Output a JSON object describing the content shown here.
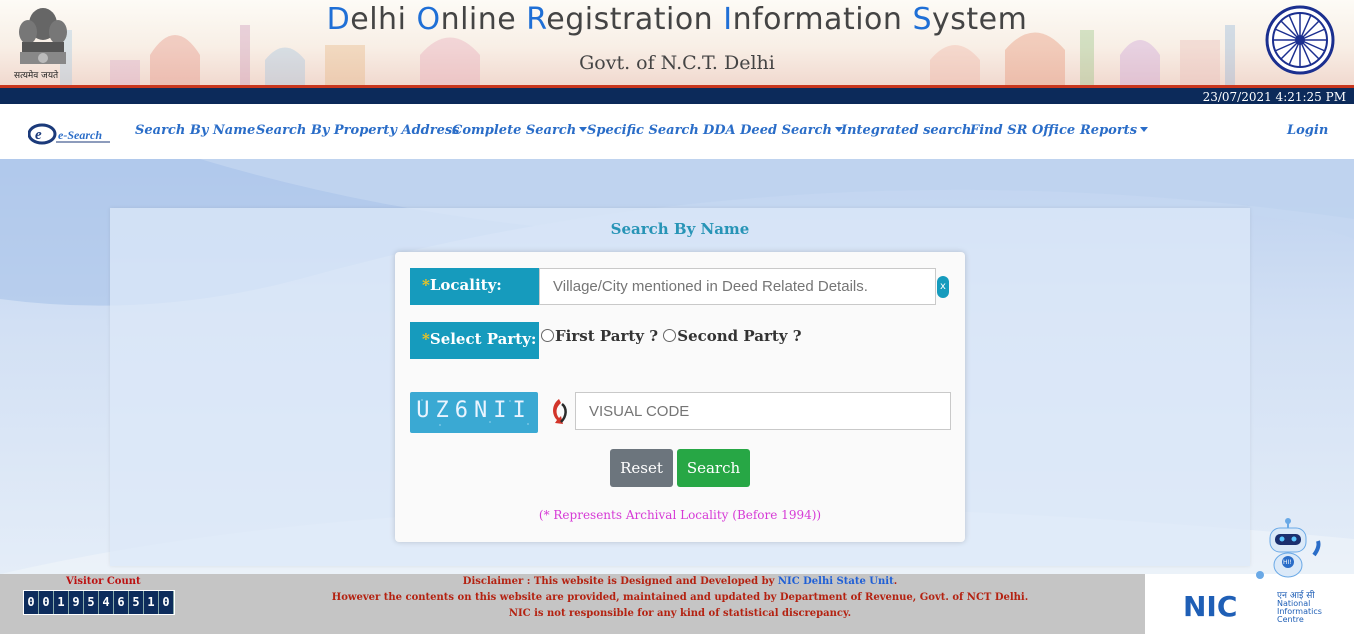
{
  "header": {
    "title_parts": [
      {
        "cap": "D",
        "rest": "elhi "
      },
      {
        "cap": "O",
        "rest": "nline "
      },
      {
        "cap": "R",
        "rest": "egistration "
      },
      {
        "cap": "I",
        "rest": "nformation "
      },
      {
        "cap": "S",
        "rest": "ystem"
      }
    ],
    "subtitle": "Govt. of N.C.T. Delhi",
    "emblem_caption": "सत्यमेव जयते",
    "datetime": "23/07/2021 4:21:25 PM"
  },
  "nav": {
    "brand": "e-Search",
    "items": [
      {
        "label": "Search By Name",
        "dropdown": false
      },
      {
        "label": "Search By Property Address",
        "dropdown": false
      },
      {
        "label": "Complete Search",
        "dropdown": true
      },
      {
        "label": "Specific Search",
        "dropdown": false
      },
      {
        "label": "DDA Deed Search",
        "dropdown": true
      },
      {
        "label": "Integrated search",
        "dropdown": false
      },
      {
        "label": "Find SR Office",
        "dropdown": false
      },
      {
        "label": "Reports",
        "dropdown": true
      }
    ],
    "login": "Login"
  },
  "form": {
    "title": "Search By Name",
    "required_mark": "*",
    "locality_label": "Locality:",
    "locality_placeholder": "Village/City mentioned in Deed Related Details.",
    "party_label": "Select Party:",
    "first_party": "First Party ?",
    "second_party": "Second Party ?",
    "captcha_text": "UZ6NII",
    "visual_code_placeholder": "VISUAL CODE",
    "reset": "Reset",
    "search": "Search",
    "note": "(* Represents Archival Locality (Before 1994))"
  },
  "footer": {
    "visitor_label": "Visitor Count",
    "visitor_digits": [
      "0",
      "0",
      "1",
      "9",
      "5",
      "4",
      "6",
      "5",
      "1",
      "0"
    ],
    "disclaimer_prefix": "Disclaimer : This website is Designed and Developed by ",
    "disclaimer_link": "NIC Delhi State Unit",
    "disclaimer_suffix": ".",
    "line2": "However the contents on this website are provided, maintained and updated by Department of Revenue, Govt. of NCT Delhi.",
    "line3": "NIC is not responsible for any kind of statistical discrepancy.",
    "nic_logo": "NIC",
    "nic_hindi": "एन आई सी",
    "nic_name": "National Informatics Centre",
    "robot_badge": "HI!"
  },
  "colors": {
    "accent": "#169bbd",
    "nav_link": "#2a6dc8",
    "datebar": "#0c2a5a",
    "search_btn": "#27a745",
    "reset_btn": "#6c757d"
  }
}
